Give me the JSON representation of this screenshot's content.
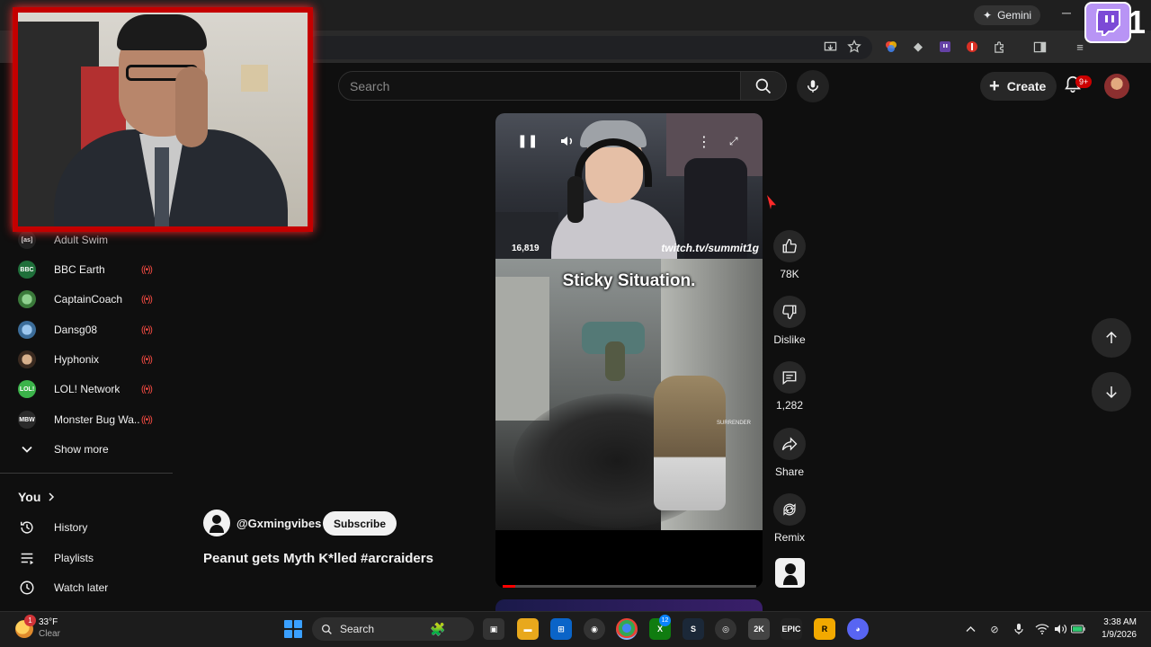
{
  "browser": {
    "gemini_label": "Gemini",
    "minimize_glyph": "─"
  },
  "twitch": {
    "icon": "twitch-icon",
    "counter": "1"
  },
  "masthead": {
    "search_placeholder": "Search",
    "create_label": "Create",
    "notification_count": "9+"
  },
  "sidebar": {
    "subscriptions": [
      {
        "name": "Adult Swim",
        "avatar_text": "[as]",
        "live": false
      },
      {
        "name": "BBC Earth",
        "avatar_text": "BBC",
        "live": true
      },
      {
        "name": "CaptainCoach",
        "avatar_text": "",
        "live": true
      },
      {
        "name": "Dansg08",
        "avatar_text": "",
        "live": true
      },
      {
        "name": "Hyphonix",
        "avatar_text": "",
        "live": true
      },
      {
        "name": "LOL! Network",
        "avatar_text": "LOL!",
        "live": true
      },
      {
        "name": "Monster Bug Wa...",
        "avatar_text": "MBW",
        "live": true
      }
    ],
    "live_glyph": "((•))",
    "show_more": "Show more",
    "you_heading": "You",
    "you_items": [
      {
        "label": "History",
        "icon": "history-icon"
      },
      {
        "label": "Playlists",
        "icon": "playlists-icon"
      },
      {
        "label": "Watch later",
        "icon": "watch-later-icon"
      }
    ]
  },
  "short": {
    "viewer_count": "16,819",
    "stream_url": "twitch.tv/summit1g",
    "caption": "Sticky Situation.",
    "surrender_tag": "SURRENDER",
    "progress": 0.05,
    "channel": "@Gxmingvibes",
    "subscribe_label": "Subscribe",
    "title": "Peanut gets Myth K*lled #arcraiders"
  },
  "actions": {
    "like_count": "78K",
    "dislike_label": "Dislike",
    "comment_count": "1,282",
    "share_label": "Share",
    "remix_label": "Remix"
  },
  "taskbar": {
    "weather_temp": "33°F",
    "weather_condition": "Clear",
    "weather_badge": "1",
    "search_label": "Search",
    "xbox_badge": "12",
    "time": "3:38 AM",
    "date": "1/9/2026"
  },
  "colors": {
    "accent_red": "#ff0000",
    "background": "#0f0f0f",
    "twitch_purple": "#b894f5",
    "webcam_border": "#c40000"
  }
}
